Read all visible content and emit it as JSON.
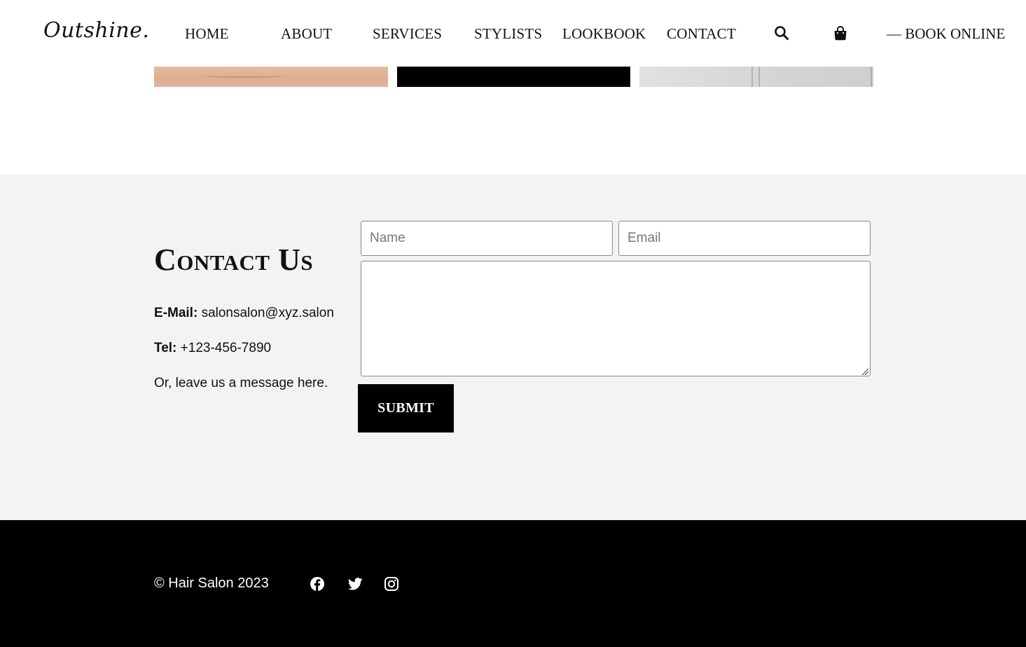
{
  "header": {
    "logo": "Outshine.",
    "nav": [
      {
        "label": "HOME"
      },
      {
        "label": "ABOUT"
      },
      {
        "label": "SERVICES"
      },
      {
        "label": "STYLISTS"
      },
      {
        "label": "LOOKBOOK"
      },
      {
        "label": "CONTACT"
      }
    ],
    "search_icon": "search-icon",
    "cart_icon": "shopping-bag-icon",
    "book_label": "— BOOK ONLINE"
  },
  "gallery": {
    "images": [
      "skin-close-up",
      "black-background",
      "gray-fabric"
    ]
  },
  "contact": {
    "title": "Contact Us",
    "email_label": "E-Mail:",
    "email_value": "salonsalon@xyz.salon",
    "tel_label": "Tel:",
    "tel_value": "+123-456-7890",
    "note": "Or, leave us a message here.",
    "form": {
      "name_placeholder": "Name",
      "email_placeholder": "Email",
      "message_value": "",
      "submit_label": "SUBMIT"
    }
  },
  "footer": {
    "copyright": "© Hair Salon 2023",
    "social": [
      "facebook-icon",
      "twitter-icon",
      "instagram-icon"
    ]
  },
  "colors": {
    "footer_bg": "#000000",
    "contact_bg": "#f2f3f4",
    "button_bg": "#000000",
    "text": "#111111"
  }
}
